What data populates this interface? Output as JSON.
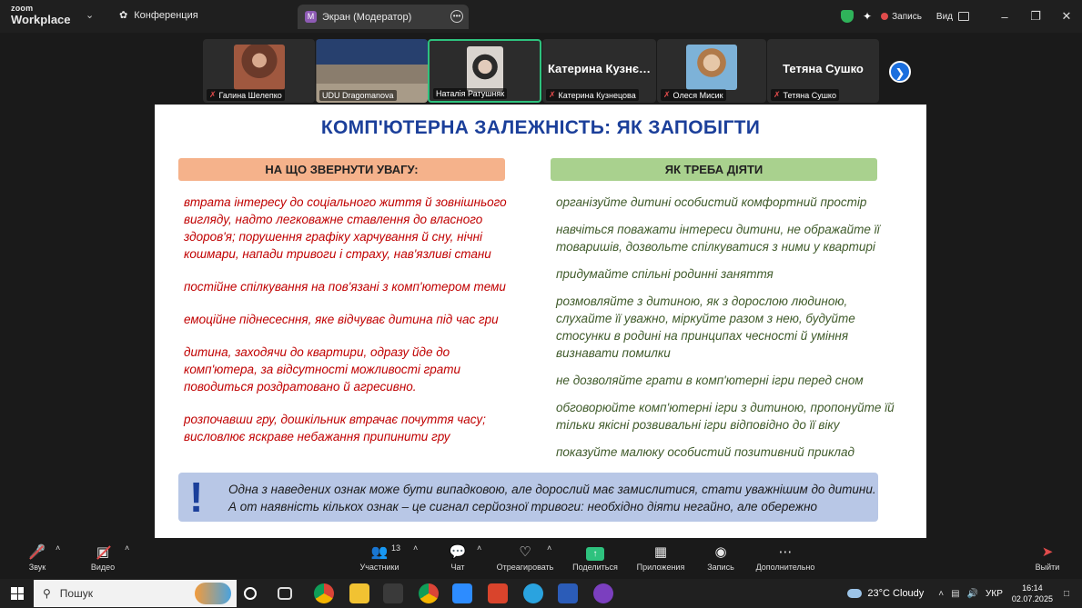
{
  "titlebar": {
    "logo_small": "zoom",
    "logo_big": "Workplace",
    "conference_label": "Конференция",
    "tab_label": "Экран (Модератор)",
    "tab_initial": "M",
    "record_label": "Запись",
    "view_label": "Вид"
  },
  "participants": [
    {
      "name": "Галина Шелепко",
      "muted": true,
      "photo_color": "#8a4a3a"
    },
    {
      "name": "UDU Dragomanova",
      "muted": false,
      "photo_color": "#3a4f7a"
    },
    {
      "name": "Наталія Ратушняк",
      "muted": false,
      "photo_color": "#c9b5a8",
      "active": true
    },
    {
      "name": "Катерина Кузнецова",
      "display_name": "Катерина  Кузнє…",
      "muted": true
    },
    {
      "name": "Олеся Мисик",
      "muted": true,
      "photo_color": "#6a9cc2"
    },
    {
      "name": "Тетяна Сушко",
      "display_name": "Тетяна Сушко",
      "muted": true
    }
  ],
  "slide": {
    "title": "КОМП'ЮТЕРНА ЗАЛЕЖНІСТЬ: ЯК ЗАПОБІГТИ",
    "left_header": "НА ЩО ЗВЕРНУТИ УВАГУ:",
    "right_header": "ЯК ТРЕБА ДІЯТИ",
    "left_items": [
      "втрата інтересу до соціального життя й зовнішнього вигляду, надто легковажне ставлення до власного здоров'я; порушення графіку харчування й сну, нічні кошмари, напади тривоги і страху, нав'язливі стани",
      "постійне спілкування на пов'язані з комп'ютером теми",
      "емоційне піднесесння, яке відчуває дитина під час гри",
      "дитина, заходячи до квартири, одразу йде до комп'ютера, за відсутності можливості грати поводиться роздратовано й агресивно.",
      "розпочавши гру, дошкільник втрачає почуття часу; висловлює яскраве небажання припинити гру"
    ],
    "right_items": [
      "організуйте дитині особистий комфортний простір",
      "навчіться поважати інтереси дитини, не ображайте її товаришів, дозвольте спілкуватися з ними у квартирі",
      "придумайте спільні родинні заняття",
      "розмовляйте з дитиною, як з дорослою людиною, слухайте її уважно, міркуйте разом з нею, будуйте стосунки в родині на принципах чесності й уміння визнавати помилки",
      "не дозволяйте грати в комп'ютерні ігри перед сном",
      "обговорюйте комп'ютерні ігри з дитиною, пропонуйте їй тільки якісні розвивальні ігри відповідно до її віку",
      "показуйте малюку особистий позитивний приклад"
    ],
    "note_mark": "!",
    "note_line1": "Одна з наведених ознак може бути випадковою, але дорослий має замислитися, стати уважнішим до дитини.",
    "note_line2": "А от наявність кількох ознак – це сигнал серйозної тривоги: необхідно діяти негайно, але обережно"
  },
  "controls": {
    "audio": "Звук",
    "video": "Видео",
    "participants": "Участники",
    "participants_count": "13",
    "chat": "Чат",
    "react": "Отреагировать",
    "share": "Поделиться",
    "apps": "Приложения",
    "record": "Запись",
    "more": "Дополнительно",
    "leave": "Выйти"
  },
  "taskbar": {
    "search_placeholder": "Пошук",
    "weather": "23°C  Cloudy",
    "lang": "УКР",
    "time": "16:14",
    "date": "02.07.2025"
  }
}
